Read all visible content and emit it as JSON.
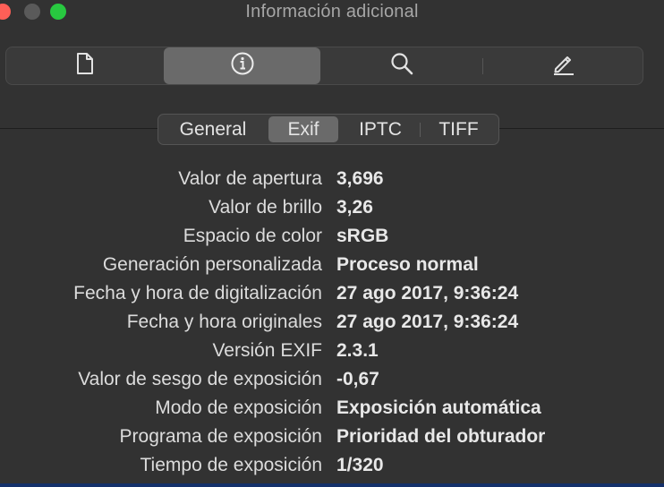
{
  "window": {
    "title": "Información adicional"
  },
  "toolbar": {
    "items": [
      {
        "name": "document",
        "icon": "document-icon",
        "active": false
      },
      {
        "name": "info",
        "icon": "info-icon",
        "active": true
      },
      {
        "name": "search",
        "icon": "magnifier-icon",
        "active": false
      },
      {
        "name": "edit",
        "icon": "pencil-icon",
        "active": false
      }
    ]
  },
  "tabs": [
    {
      "label": "General",
      "active": false
    },
    {
      "label": "Exif",
      "active": true
    },
    {
      "label": "IPTC",
      "active": false
    },
    {
      "label": "TIFF",
      "active": false
    }
  ],
  "rows": [
    {
      "key": "Valor de apertura",
      "value": "3,696"
    },
    {
      "key": "Valor de brillo",
      "value": "3,26"
    },
    {
      "key": "Espacio de color",
      "value": "sRGB"
    },
    {
      "key": "Generación personalizada",
      "value": "Proceso normal"
    },
    {
      "key": "Fecha y hora de digitalización",
      "value": "27 ago 2017, 9:36:24"
    },
    {
      "key": "Fecha y hora originales",
      "value": "27 ago 2017, 9:36:24"
    },
    {
      "key": "Versión EXIF",
      "value": "2.3.1"
    },
    {
      "key": "Valor de sesgo de exposición",
      "value": "-0,67"
    },
    {
      "key": "Modo de exposición",
      "value": "Exposición automática"
    },
    {
      "key": "Programa de exposición",
      "value": "Prioridad del obturador"
    },
    {
      "key": "Tiempo de exposición",
      "value": "1/320"
    }
  ],
  "colors": {
    "background": "#323232",
    "active_segment": "#6a6a6a",
    "close": "#ff5f57",
    "zoom": "#28c840"
  }
}
